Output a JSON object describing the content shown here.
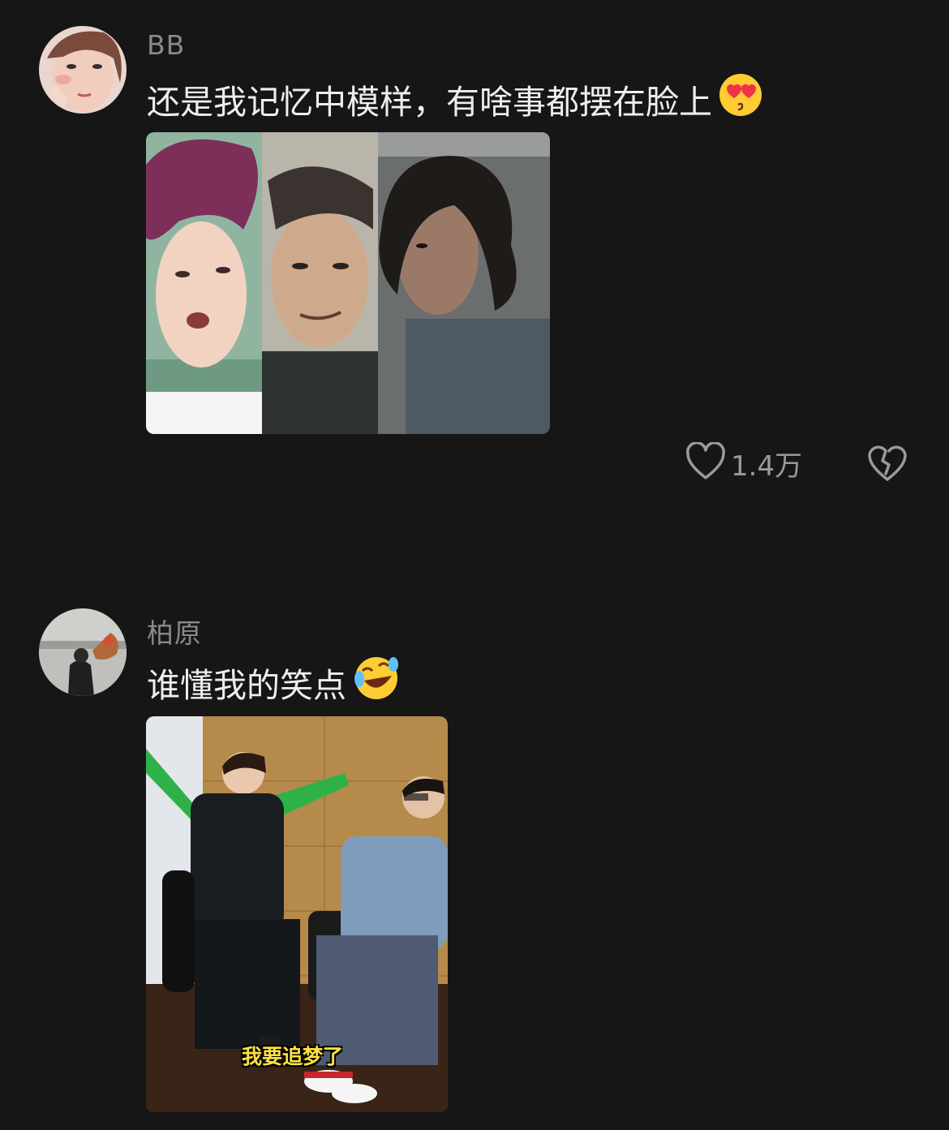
{
  "comments": [
    {
      "username": "BB",
      "text": "还是我记忆中模样，有啥事都摆在脸上",
      "emoji_icon": "heart-eyes-kiss-emoji",
      "likes": "1.4万"
    },
    {
      "username": "柏原",
      "text": "谁懂我的笑点",
      "emoji_icon": "rolling-laughing-emoji",
      "media_caption": "我要追梦了"
    }
  ],
  "icons": {
    "like": "heart-outline-icon",
    "dislike": "broken-heart-icon"
  }
}
